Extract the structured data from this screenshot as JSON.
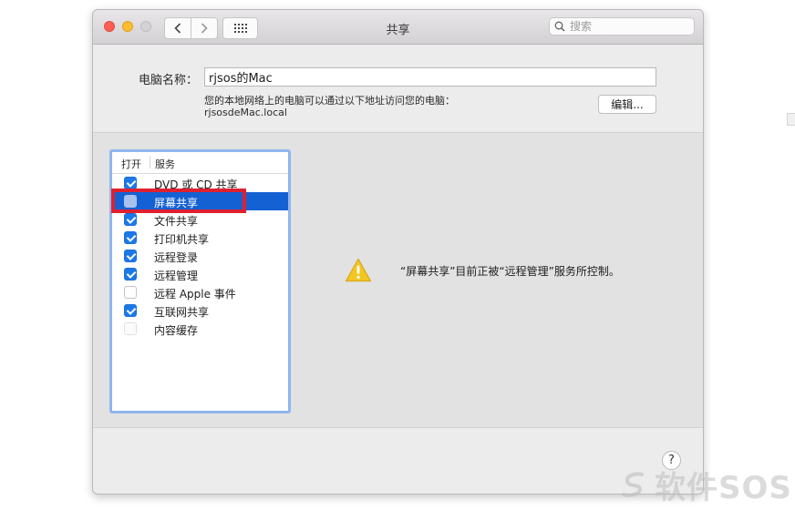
{
  "window": {
    "title": "共享",
    "search": {
      "placeholder": "搜索",
      "value": ""
    }
  },
  "computer_name": {
    "label": "电脑名称：",
    "value": "rjsos的Mac",
    "note": "您的本地网络上的电脑可以通过以下地址访问您的电脑：",
    "address": "rjsosdeMac.local",
    "edit_label": "编辑..."
  },
  "services": {
    "header_open": "打开",
    "header_service": "服务",
    "items": [
      {
        "label": "DVD 或 CD 共享",
        "checked": true,
        "selected": false,
        "disabled": false
      },
      {
        "label": "屏幕共享",
        "checked": false,
        "selected": true,
        "disabled": false
      },
      {
        "label": "文件共享",
        "checked": true,
        "selected": false,
        "disabled": false
      },
      {
        "label": "打印机共享",
        "checked": true,
        "selected": false,
        "disabled": false
      },
      {
        "label": "远程登录",
        "checked": true,
        "selected": false,
        "disabled": false
      },
      {
        "label": "远程管理",
        "checked": true,
        "selected": false,
        "disabled": false
      },
      {
        "label": "远程 Apple 事件",
        "checked": false,
        "selected": false,
        "disabled": false
      },
      {
        "label": "互联网共享",
        "checked": true,
        "selected": false,
        "disabled": false
      },
      {
        "label": "内容缓存",
        "checked": false,
        "selected": false,
        "disabled": true
      }
    ]
  },
  "detail": {
    "message": "“屏幕共享”目前正被“远程管理”服务所控制。"
  },
  "help_label": "?",
  "watermark_text": "软件SOS",
  "colors": {
    "selection": "#1461d3",
    "checkbox_on": "#1c78e8",
    "highlight_box": "#df2030",
    "warning": "#f3c623"
  }
}
